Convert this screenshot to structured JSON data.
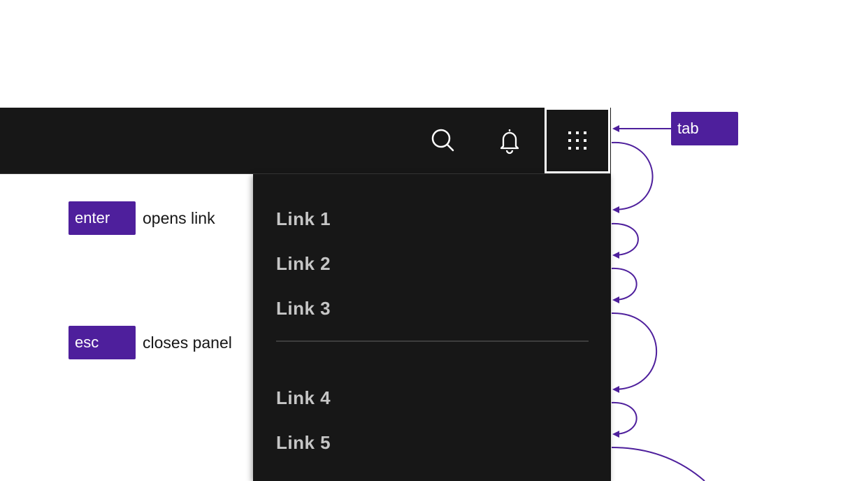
{
  "header": {
    "buttons": [
      {
        "name": "search-button",
        "icon": "search-icon"
      },
      {
        "name": "notifications-button",
        "icon": "bell-icon"
      },
      {
        "name": "app-switcher-button",
        "icon": "grid-icon",
        "focused": true
      }
    ]
  },
  "panel": {
    "links": [
      "Link 1",
      "Link 2",
      "Link 3",
      "Link 4",
      "Link 5"
    ]
  },
  "annotations": {
    "tab_key": "tab",
    "enter_key": "enter",
    "enter_desc": "opens link",
    "esc_key": "esc",
    "esc_desc": "closes panel"
  },
  "colors": {
    "header_bg": "#171717",
    "link_text": "#c6c6c6",
    "key_bg": "#4e1f9c",
    "arrow": "#4e1f9c"
  }
}
